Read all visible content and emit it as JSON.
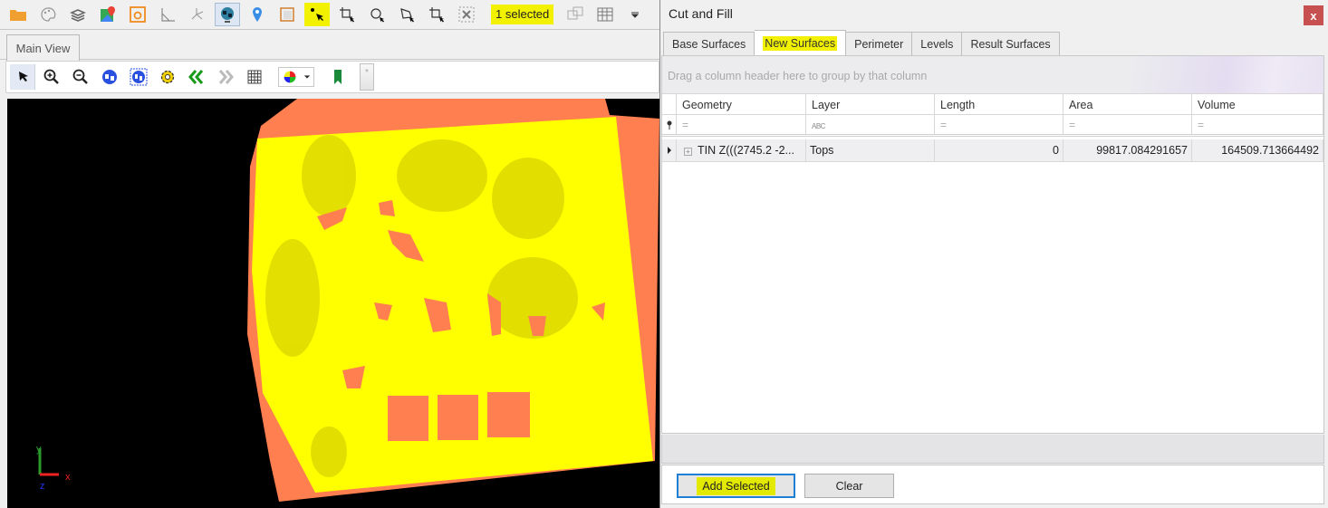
{
  "toolbar": {
    "icons": [
      "open-folder",
      "palette",
      "layers",
      "google-maps",
      "bing-maps",
      "measure-angle",
      "xyz-axes",
      "globe-3d",
      "location-pin",
      "layout-frame",
      "select-point",
      "select-vertex",
      "select-circle",
      "select-polygon",
      "select-rectangle",
      "clear-selection",
      "select-window",
      "table-view",
      "overflow-menu"
    ],
    "selected_count_label": "1 selected"
  },
  "main_tab": {
    "label": "Main View"
  },
  "view_toolbar": {
    "icons": [
      "pointer",
      "zoom-in",
      "zoom-out",
      "globe-extent",
      "globe-full",
      "settings-gear",
      "previous-view",
      "next-view",
      "grid",
      "color-palette-dropdown",
      "bookmark",
      "star"
    ],
    "star_label": "*"
  },
  "viewport": {
    "axis": {
      "x_label": "x",
      "y_label": "y",
      "z_label": "z"
    },
    "colors": {
      "surface_fill": "#ffff00",
      "cut_fill": "#ff7f50",
      "background": "#000000"
    }
  },
  "dialog": {
    "title": "Cut and Fill",
    "close_label": "x",
    "tabs": [
      {
        "label": "Base Surfaces",
        "active": false
      },
      {
        "label": "New Surfaces",
        "active": true
      },
      {
        "label": "Perimeter",
        "active": false
      },
      {
        "label": "Levels",
        "active": false
      },
      {
        "label": "Result Surfaces",
        "active": false
      }
    ],
    "group_panel_text": "Drag a column header here to group by that column",
    "columns": [
      "Geometry",
      "Layer",
      "Length",
      "Area",
      "Volume"
    ],
    "filter_row": [
      "=",
      "ABC",
      "=",
      "=",
      "="
    ],
    "rows": [
      {
        "geometry": "TIN Z(((2745.2 -2...",
        "layer": "Tops",
        "length": "0",
        "area": "99817.084291657",
        "volume": "164509.713664492"
      }
    ],
    "buttons": {
      "add_selected": "Add Selected",
      "clear": "Clear"
    },
    "accent_highlight": "#f2f200"
  }
}
